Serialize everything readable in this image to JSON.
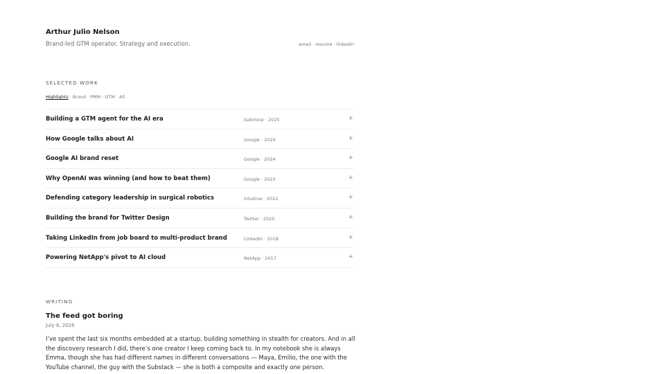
{
  "header": {
    "name": "Arthur Julio Nelson",
    "tagline": "Brand-led GTM operator. Strategy and execution.",
    "links": [
      "email",
      "resume",
      "linkedin"
    ],
    "separator": "·"
  },
  "selected_work": {
    "label": "SELECTED WORK",
    "filters": [
      {
        "label": "Highlights",
        "active": true
      },
      {
        "label": "Brand",
        "active": false
      },
      {
        "label": "PMM",
        "active": false
      },
      {
        "label": "GTM",
        "active": false
      },
      {
        "label": "All",
        "active": false
      }
    ],
    "items": [
      {
        "title": "Building a GTM agent for the AI era",
        "meta": "Saltmine · 2025",
        "expand_icon": "plus-icon",
        "expand_glyph": "+"
      },
      {
        "title": "How Google talks about AI",
        "meta": "Google · 2024",
        "expand_icon": "plus-icon",
        "expand_glyph": "+"
      },
      {
        "title": "Google AI brand reset",
        "meta": "Google · 2024",
        "expand_icon": "plus-icon",
        "expand_glyph": "+"
      },
      {
        "title": "Why OpenAI was winning (and how to beat them)",
        "meta": "Google · 2023",
        "expand_icon": "plus-icon",
        "expand_glyph": "+"
      },
      {
        "title": "Defending category leadership in surgical robotics",
        "meta": "Intuitive · 2022",
        "expand_icon": "plus-icon",
        "expand_glyph": "+"
      },
      {
        "title": "Building the brand for Twitter Design",
        "meta": "Twitter · 2020",
        "expand_icon": "plus-icon",
        "expand_glyph": "+"
      },
      {
        "title": "Taking LinkedIn from job board to multi-product brand",
        "meta": "LinkedIn · 2018",
        "expand_icon": "plus-icon",
        "expand_glyph": "+"
      },
      {
        "title": "Powering NetApp's pivot to AI cloud",
        "meta": "NetApp · 2017",
        "expand_icon": "plus-icon",
        "expand_glyph": "+"
      }
    ]
  },
  "writing": {
    "label": "WRITING",
    "post": {
      "title": "The feed got boring",
      "date": "July 8, 2026",
      "body": "I’ve spent the last six months embedded at a startup, building something in stealth for creators. And in all the discovery research I did, there’s one creator I keep coming back to. In my notebook she is always Emma, though she has had different names in different conversations — Maya, Emilio, the one with the YouTube channel, the guy with the Substack — she is both a composite and exactly one person."
    }
  },
  "colors": {
    "text": "#1c1c1c",
    "muted": "#777777",
    "divider": "#ececec",
    "background": "#ffffff"
  }
}
